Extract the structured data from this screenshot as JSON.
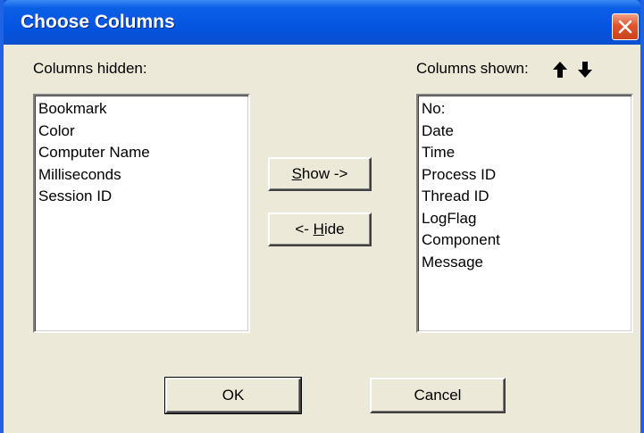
{
  "window": {
    "title": "Choose Columns",
    "close_icon": "close-icon"
  },
  "hidden": {
    "label": "Columns hidden:",
    "items": [
      "Bookmark",
      "Color",
      "Computer Name",
      "Milliseconds",
      "Session ID"
    ]
  },
  "shown": {
    "label": "Columns shown:",
    "up_icon": "arrow-up-icon",
    "down_icon": "arrow-down-icon",
    "items": [
      "No:",
      "Date",
      "Time",
      "Process ID",
      "Thread ID",
      "LogFlag",
      "Component",
      "Message"
    ]
  },
  "buttons": {
    "show": {
      "mnemonic": "S",
      "rest": "how ->"
    },
    "hide": {
      "prefix": "<- ",
      "mnemonic": "H",
      "rest": "ide"
    },
    "ok": "OK",
    "cancel": "Cancel"
  },
  "colors": {
    "titlebar": "#0554e0",
    "dialog_face": "#ece9d8",
    "close_button": "#e0562e"
  }
}
